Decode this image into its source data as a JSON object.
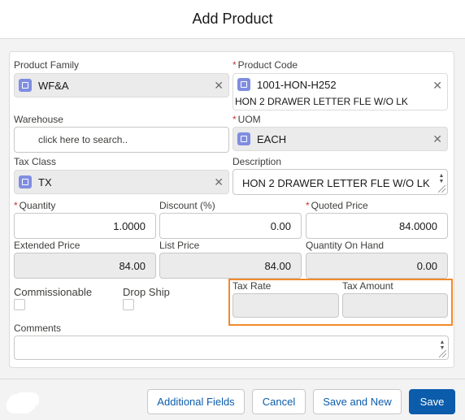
{
  "modal": {
    "title": "Add Product"
  },
  "fields": {
    "product_family": {
      "label": "Product Family",
      "value": "WF&A"
    },
    "product_code": {
      "label": "Product Code",
      "value": "1001-HON-H252",
      "subtext": "HON 2 DRAWER LETTER FLE W/O LK"
    },
    "warehouse": {
      "label": "Warehouse",
      "placeholder": "click here to search.."
    },
    "uom": {
      "label": "UOM",
      "value": "EACH"
    },
    "tax_class": {
      "label": "Tax Class",
      "value": "TX"
    },
    "description": {
      "label": "Description",
      "value": "HON 2 DRAWER LETTER FLE W/O LK"
    },
    "quantity": {
      "label": "Quantity",
      "value": "1.0000"
    },
    "discount": {
      "label": "Discount (%)",
      "value": "0.00"
    },
    "quoted_price": {
      "label": "Quoted Price",
      "value": "84.0000"
    },
    "extended_price": {
      "label": "Extended Price",
      "value": "84.00"
    },
    "list_price": {
      "label": "List Price",
      "value": "84.00"
    },
    "quantity_on_hand": {
      "label": "Quantity On Hand",
      "value": "0.00"
    },
    "commissionable": {
      "label": "Commissionable"
    },
    "drop_ship": {
      "label": "Drop Ship"
    },
    "tax_rate": {
      "label": "Tax Rate",
      "value": ""
    },
    "tax_amount": {
      "label": "Tax Amount",
      "value": ""
    },
    "comments": {
      "label": "Comments",
      "value": ""
    }
  },
  "required_marker": "*",
  "clear_glyph": "✕",
  "footer": {
    "additional_fields": "Additional Fields",
    "cancel": "Cancel",
    "save_and_new": "Save and New",
    "save": "Save"
  },
  "colors": {
    "brand": "#0b5cab",
    "highlight": "#f08a2a",
    "lookup_icon": "#7f8de1",
    "required": "#c23934"
  },
  "icons": {
    "lookup": "record-lookup-icon",
    "clear": "close-icon"
  }
}
